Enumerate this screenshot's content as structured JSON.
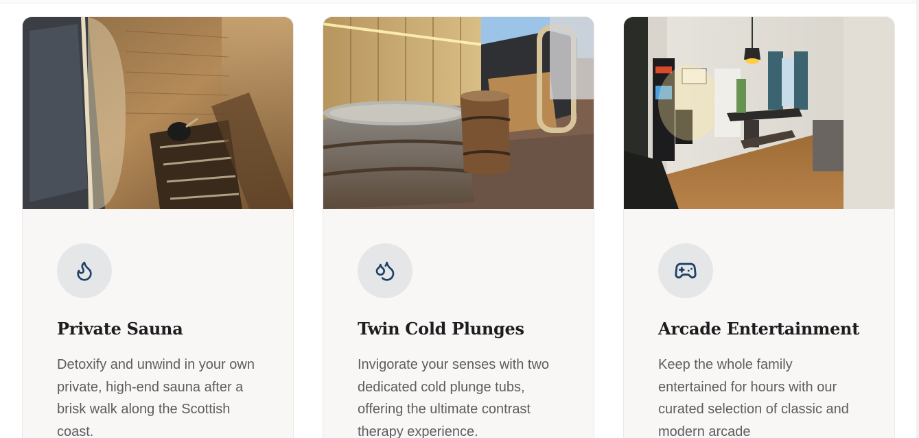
{
  "features": [
    {
      "title": "Private Sauna",
      "description": "Detoxify and unwind in your own private, high-end sauna after a brisk walk along the Scottish coast.",
      "icon": "flame-icon"
    },
    {
      "title": "Twin Cold Plunges",
      "description": "Invigorate your senses with two dedicated cold plunge tubs, offering the ultimate contrast therapy experience.",
      "icon": "droplets-icon"
    },
    {
      "title": "Arcade Entertainment",
      "description": "Keep the whole family entertained for hours with our curated selection of classic and modern arcade",
      "icon": "gamepad-icon"
    }
  ],
  "theme": {
    "icon_color": "#1f3f66",
    "icon_bg": "#e4e6e8",
    "card_bg": "#f8f7f5",
    "title_color": "#1d1d1f",
    "text_color": "#5d5d5d"
  }
}
